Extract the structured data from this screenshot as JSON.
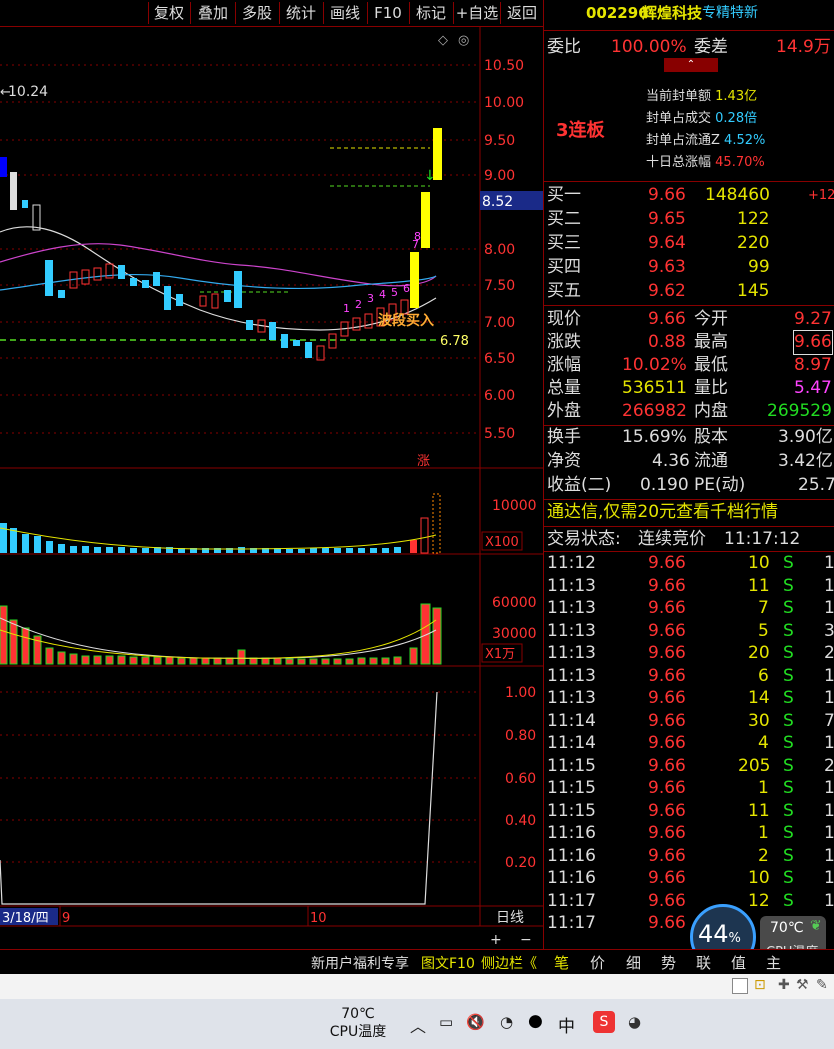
{
  "toolbar": {
    "items": [
      "复权",
      "叠加",
      "多股",
      "统计",
      "画线",
      "F10",
      "标记",
      "+自选",
      "返回"
    ]
  },
  "stock": {
    "code": "002296",
    "name": "辉煌科技",
    "tag": "专精特新"
  },
  "weibi": {
    "label": "委比",
    "value": "100.00%",
    "diff_label": "委差",
    "diff_value": "14.9万"
  },
  "limit_info": {
    "streak": "3连板",
    "rows": [
      {
        "label": "当前封单额",
        "value": "1.43亿"
      },
      {
        "label": "封单占成交",
        "value": "0.28倍"
      },
      {
        "label": "封单占流通Z",
        "value": "4.52%"
      },
      {
        "label": "十日总涨幅",
        "value": "45.70%"
      }
    ]
  },
  "bids": [
    {
      "label": "买一",
      "price": "9.66",
      "vol": "148460",
      "extra": "+12"
    },
    {
      "label": "买二",
      "price": "9.65",
      "vol": "122",
      "extra": ""
    },
    {
      "label": "买三",
      "price": "9.64",
      "vol": "220",
      "extra": ""
    },
    {
      "label": "买四",
      "price": "9.63",
      "vol": "99",
      "extra": ""
    },
    {
      "label": "买五",
      "price": "9.62",
      "vol": "145",
      "extra": ""
    }
  ],
  "quote": [
    {
      "l1": "现价",
      "v1": "9.66",
      "l2": "今开",
      "v2": "9.27"
    },
    {
      "l1": "涨跌",
      "v1": "0.88",
      "l2": "最高",
      "v2": "9.66"
    },
    {
      "l1": "涨幅",
      "v1": "10.02%",
      "l2": "最低",
      "v2": "8.97"
    },
    {
      "l1": "总量",
      "v1": "536511",
      "l2": "量比",
      "v2": "5.47"
    },
    {
      "l1": "外盘",
      "v1": "266982",
      "l2": "内盘",
      "v2": "269529"
    }
  ],
  "fundamentals": [
    {
      "l1": "换手",
      "v1": "15.69%",
      "l2": "股本",
      "v2": "3.90亿"
    },
    {
      "l1": "净资",
      "v1": "4.36",
      "l2": "流通",
      "v2": "3.42亿"
    },
    {
      "l1": "收益(二)",
      "v1": "0.190",
      "l2": "PE(动)",
      "v2": "25.7"
    }
  ],
  "promo": "通达信,仅需20元查看千档行情",
  "trade_status": {
    "label": "交易状态:",
    "value": "连续竞价",
    "time": "11:17:12"
  },
  "ticks": [
    {
      "t": "11:12",
      "p": "9.66",
      "v": "10",
      "s": "S",
      "n": "1"
    },
    {
      "t": "11:13",
      "p": "9.66",
      "v": "11",
      "s": "S",
      "n": "1"
    },
    {
      "t": "11:13",
      "p": "9.66",
      "v": "7",
      "s": "S",
      "n": "1"
    },
    {
      "t": "11:13",
      "p": "9.66",
      "v": "5",
      "s": "S",
      "n": "3"
    },
    {
      "t": "11:13",
      "p": "9.66",
      "v": "20",
      "s": "S",
      "n": "2"
    },
    {
      "t": "11:13",
      "p": "9.66",
      "v": "6",
      "s": "S",
      "n": "1"
    },
    {
      "t": "11:13",
      "p": "9.66",
      "v": "14",
      "s": "S",
      "n": "1"
    },
    {
      "t": "11:14",
      "p": "9.66",
      "v": "30",
      "s": "S",
      "n": "7"
    },
    {
      "t": "11:14",
      "p": "9.66",
      "v": "4",
      "s": "S",
      "n": "1"
    },
    {
      "t": "11:15",
      "p": "9.66",
      "v": "205",
      "s": "S",
      "n": "2"
    },
    {
      "t": "11:15",
      "p": "9.66",
      "v": "1",
      "s": "S",
      "n": "1"
    },
    {
      "t": "11:15",
      "p": "9.66",
      "v": "11",
      "s": "S",
      "n": "1"
    },
    {
      "t": "11:16",
      "p": "9.66",
      "v": "1",
      "s": "S",
      "n": "1"
    },
    {
      "t": "11:16",
      "p": "9.66",
      "v": "2",
      "s": "S",
      "n": "1"
    },
    {
      "t": "11:16",
      "p": "9.66",
      "v": "10",
      "s": "S",
      "n": "1"
    },
    {
      "t": "11:17",
      "p": "9.66",
      "v": "12",
      "s": "S",
      "n": "1"
    },
    {
      "t": "11:17",
      "p": "9.66",
      "v": "",
      "s": "",
      "n": ""
    }
  ],
  "panel_tabs": [
    "笔",
    "价",
    "细",
    "势",
    "联",
    "值",
    "主"
  ],
  "bottom_bar": {
    "welfare": "新用户福利专享",
    "f10": "图文F10",
    "sidebar": "侧边栏《",
    "period": "日线"
  },
  "chart_labels": {
    "price_ticks": [
      "10.50",
      "10.00",
      "9.50",
      "9.00",
      "8.00",
      "7.50",
      "7.00",
      "6.50",
      "6.00",
      "5.50"
    ],
    "current_price": "8.52",
    "top_left_value": "10.24",
    "line_value": "6.78",
    "buy_signal": "波段买入",
    "limit_tag": "涨",
    "vol_ticks": [
      "10000"
    ],
    "vol_unit": "X100",
    "amt_ticks": [
      "60000",
      "30000"
    ],
    "amt_unit": "X1万",
    "ind_ticks": [
      "1.00",
      "0.80",
      "0.60",
      "0.40",
      "0.20"
    ],
    "date_left": "3/18/四",
    "date_mid": "9",
    "date_right": "10",
    "seq_numbers": [
      "1",
      "2",
      "3",
      "4",
      "5",
      "6",
      "7",
      "8"
    ]
  },
  "cpu_widget": {
    "percent": "44",
    "unit": "%",
    "temp": "70℃",
    "label": "CPU温度"
  },
  "taskbar": {
    "temp": "70℃",
    "label": "CPU温度",
    "ime": "中"
  }
}
